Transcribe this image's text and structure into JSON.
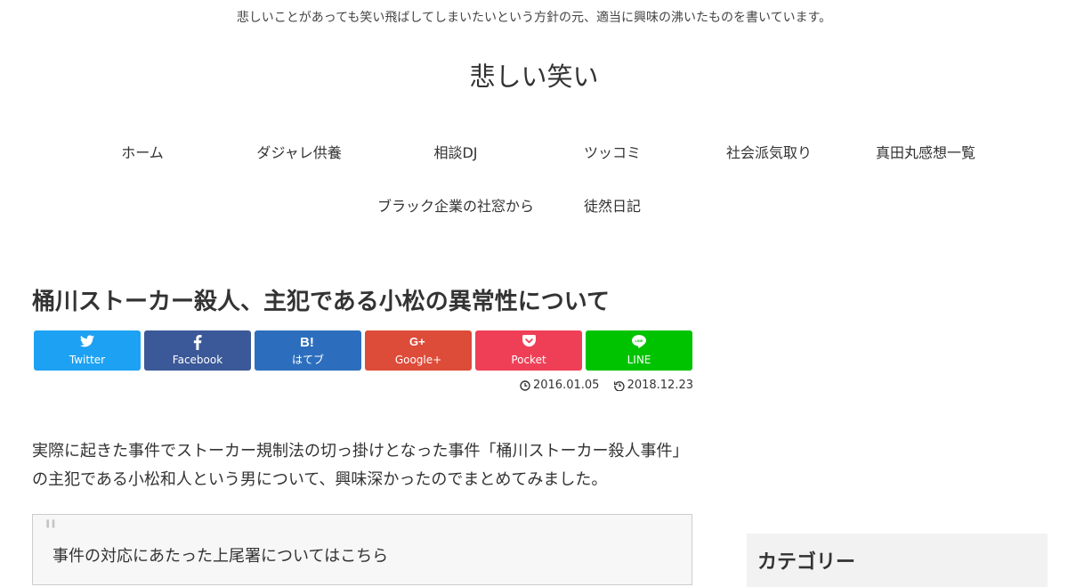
{
  "header": {
    "tagline": "悲しいことがあっても笑い飛ばしてしまいたいという方針の元、適当に興味の沸いたものを書いています。",
    "site_title": "悲しい笑い"
  },
  "nav": {
    "row1": [
      "ホーム",
      "ダジャレ供養",
      "相談DJ",
      "ツッコミ",
      "社会派気取り",
      "真田丸感想一覧"
    ],
    "row2": [
      "ブラック企業の社窓から",
      "徒然日記"
    ]
  },
  "article": {
    "title": "桶川ストーカー殺人、主犯である小松の異常性について",
    "share": [
      {
        "label": "Twitter",
        "icon": "twitter-icon",
        "color": "#1da1f2"
      },
      {
        "label": "Facebook",
        "icon": "facebook-icon",
        "color": "#3b5998"
      },
      {
        "label": "はてブ",
        "icon": "hatebu-icon",
        "color": "#2c6ebd"
      },
      {
        "label": "Google+",
        "icon": "google-plus-icon",
        "color": "#dd4b39"
      },
      {
        "label": "Pocket",
        "icon": "pocket-icon",
        "color": "#ef3f56"
      },
      {
        "label": "LINE",
        "icon": "line-icon",
        "color": "#00c300"
      }
    ],
    "published": "2016.01.05",
    "updated": "2018.12.23",
    "lead_line1": "実際に起きた事件でストーカー規制法の切っ掛けとなった事件「桶川ストーカー殺人事件」",
    "lead_line2": "の主犯である小松和人という男について、興味深かったのでまとめてみました。",
    "quote_text": "事件の対応にあたった上尾署についてはこちら"
  },
  "sidebar": {
    "widget_title": "カテゴリー"
  }
}
